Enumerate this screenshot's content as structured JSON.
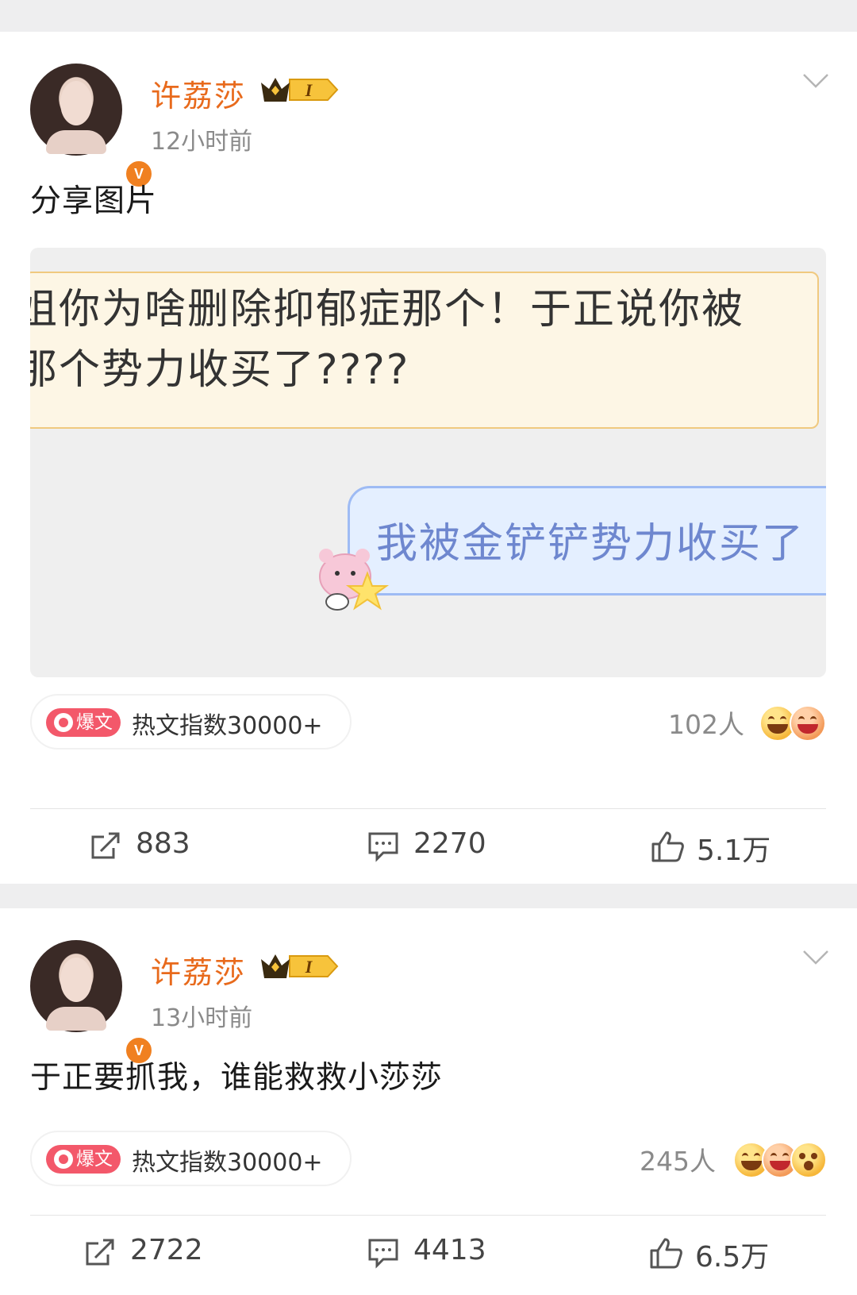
{
  "posts": [
    {
      "username": "许荔莎",
      "vip_level": "I",
      "verified_badge": "V",
      "time": "12小时前",
      "text": "分享图片",
      "image": {
        "msg_left": "姐你为啥删除抑郁症那个！于正说你被\n那个势力收买了????",
        "msg_right": "我被金铲铲势力收买了"
      },
      "hot_tag": "爆文",
      "hot_text": "热文指数30000+",
      "reaction_count": "102人",
      "reactions": [
        "grin-emoji",
        "laugh-emoji"
      ],
      "reposts": "883",
      "comments": "2270",
      "likes": "5.1万"
    },
    {
      "username": "许荔莎",
      "vip_level": "I",
      "verified_badge": "V",
      "time": "13小时前",
      "text": "于正要抓我，谁能救救小莎莎",
      "hot_tag": "爆文",
      "hot_text": "热文指数30000+",
      "reaction_count": "245人",
      "reactions": [
        "grin-emoji",
        "laugh-emoji",
        "surprised-emoji"
      ],
      "reposts": "2722",
      "comments": "4413",
      "likes": "6.5万"
    }
  ],
  "colors": {
    "username": "#e86a1c",
    "hot_tag": "#f3586a",
    "muted": "#8a8a8a",
    "feed_bg": "#eeeeef"
  }
}
